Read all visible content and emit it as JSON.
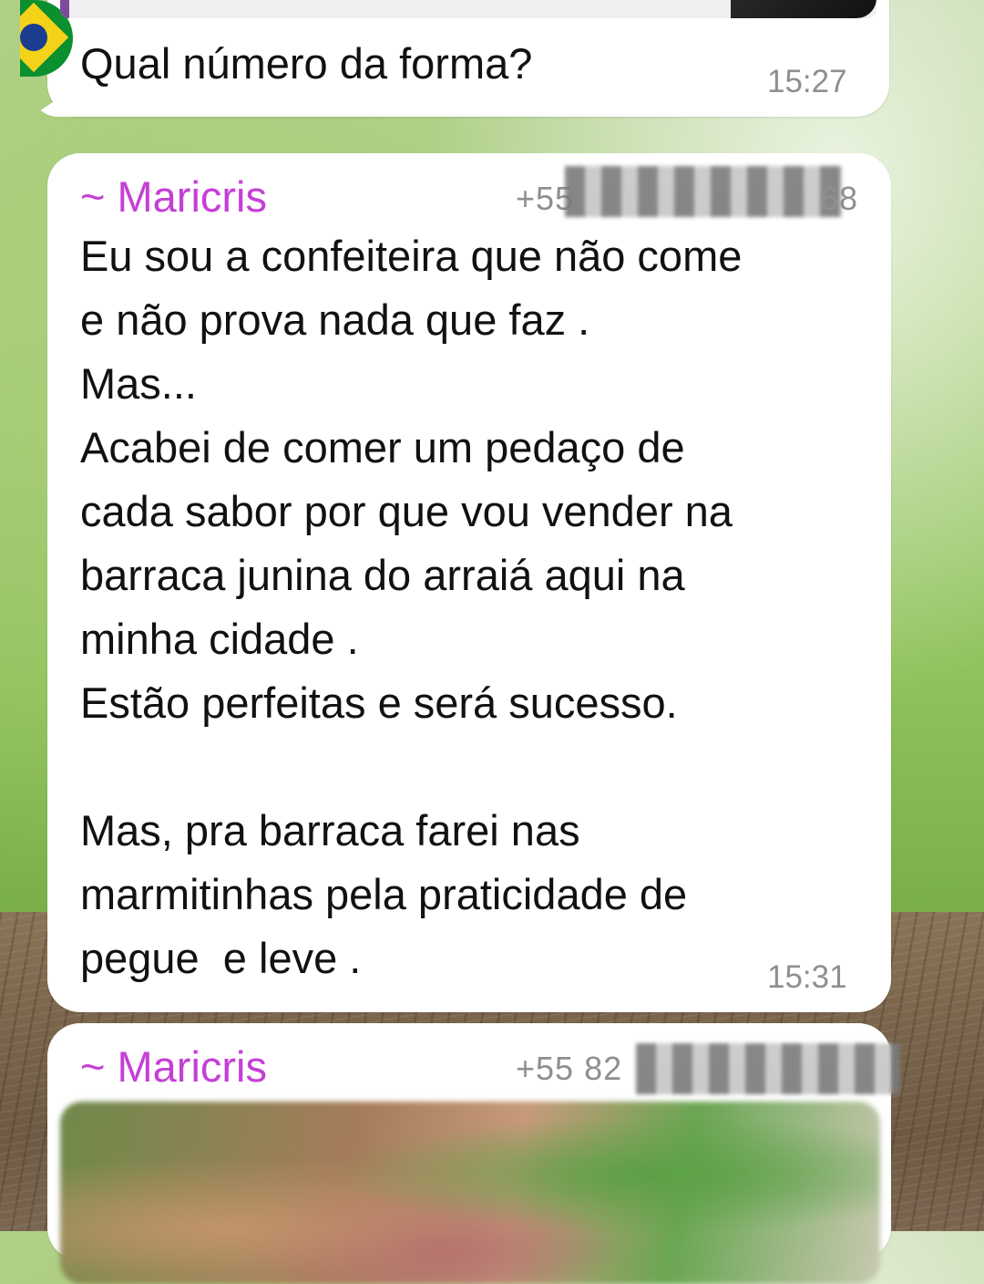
{
  "messages": [
    {
      "text": "Qual número da forma?",
      "time": "15:27"
    },
    {
      "sender": "~ Maricris",
      "phone_visible_start": "+55",
      "phone_visible_end": "68",
      "text": "Eu sou a confeiteira que não come\ne não prova nada que faz .\nMas...\nAcabei de comer um pedaço de\ncada sabor por que vou vender na\nbarraca junina do arraiá aqui na\nminha cidade .\nEstão perfeitas e será sucesso.\n\nMas, pra barraca farei nas\nmarmitinhas pela praticidade de\npegue  e leve .",
      "time": "15:31"
    },
    {
      "sender": "~ Maricris",
      "phone_visible_start": "+55 82"
    }
  ],
  "colors": {
    "sender": "#c53fd6",
    "timestamp": "#8e8e93",
    "bubble": "#ffffff"
  },
  "icons": {
    "avatar": "brazil-flag-avatar"
  }
}
